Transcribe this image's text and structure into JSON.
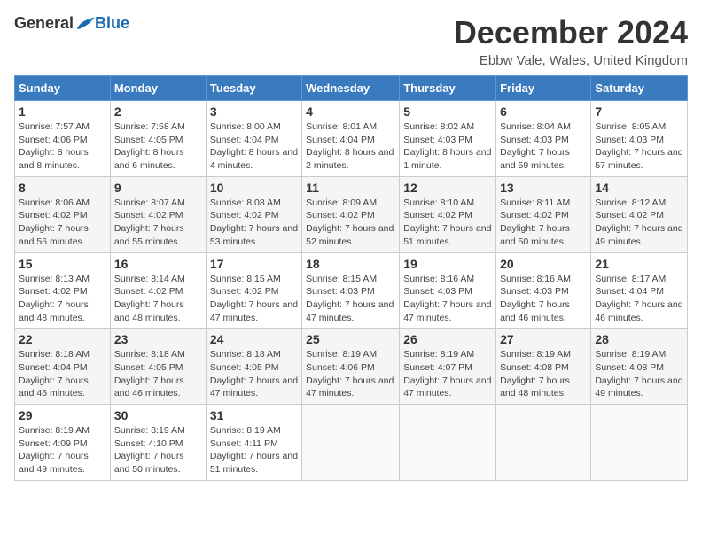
{
  "header": {
    "logo_general": "General",
    "logo_blue": "Blue",
    "month_title": "December 2024",
    "location": "Ebbw Vale, Wales, United Kingdom"
  },
  "days_of_week": [
    "Sunday",
    "Monday",
    "Tuesday",
    "Wednesday",
    "Thursday",
    "Friday",
    "Saturday"
  ],
  "weeks": [
    [
      {
        "day": "1",
        "info": "Sunrise: 7:57 AM\nSunset: 4:06 PM\nDaylight: 8 hours and 8 minutes."
      },
      {
        "day": "2",
        "info": "Sunrise: 7:58 AM\nSunset: 4:05 PM\nDaylight: 8 hours and 6 minutes."
      },
      {
        "day": "3",
        "info": "Sunrise: 8:00 AM\nSunset: 4:04 PM\nDaylight: 8 hours and 4 minutes."
      },
      {
        "day": "4",
        "info": "Sunrise: 8:01 AM\nSunset: 4:04 PM\nDaylight: 8 hours and 2 minutes."
      },
      {
        "day": "5",
        "info": "Sunrise: 8:02 AM\nSunset: 4:03 PM\nDaylight: 8 hours and 1 minute."
      },
      {
        "day": "6",
        "info": "Sunrise: 8:04 AM\nSunset: 4:03 PM\nDaylight: 7 hours and 59 minutes."
      },
      {
        "day": "7",
        "info": "Sunrise: 8:05 AM\nSunset: 4:03 PM\nDaylight: 7 hours and 57 minutes."
      }
    ],
    [
      {
        "day": "8",
        "info": "Sunrise: 8:06 AM\nSunset: 4:02 PM\nDaylight: 7 hours and 56 minutes."
      },
      {
        "day": "9",
        "info": "Sunrise: 8:07 AM\nSunset: 4:02 PM\nDaylight: 7 hours and 55 minutes."
      },
      {
        "day": "10",
        "info": "Sunrise: 8:08 AM\nSunset: 4:02 PM\nDaylight: 7 hours and 53 minutes."
      },
      {
        "day": "11",
        "info": "Sunrise: 8:09 AM\nSunset: 4:02 PM\nDaylight: 7 hours and 52 minutes."
      },
      {
        "day": "12",
        "info": "Sunrise: 8:10 AM\nSunset: 4:02 PM\nDaylight: 7 hours and 51 minutes."
      },
      {
        "day": "13",
        "info": "Sunrise: 8:11 AM\nSunset: 4:02 PM\nDaylight: 7 hours and 50 minutes."
      },
      {
        "day": "14",
        "info": "Sunrise: 8:12 AM\nSunset: 4:02 PM\nDaylight: 7 hours and 49 minutes."
      }
    ],
    [
      {
        "day": "15",
        "info": "Sunrise: 8:13 AM\nSunset: 4:02 PM\nDaylight: 7 hours and 48 minutes."
      },
      {
        "day": "16",
        "info": "Sunrise: 8:14 AM\nSunset: 4:02 PM\nDaylight: 7 hours and 48 minutes."
      },
      {
        "day": "17",
        "info": "Sunrise: 8:15 AM\nSunset: 4:02 PM\nDaylight: 7 hours and 47 minutes."
      },
      {
        "day": "18",
        "info": "Sunrise: 8:15 AM\nSunset: 4:03 PM\nDaylight: 7 hours and 47 minutes."
      },
      {
        "day": "19",
        "info": "Sunrise: 8:16 AM\nSunset: 4:03 PM\nDaylight: 7 hours and 47 minutes."
      },
      {
        "day": "20",
        "info": "Sunrise: 8:16 AM\nSunset: 4:03 PM\nDaylight: 7 hours and 46 minutes."
      },
      {
        "day": "21",
        "info": "Sunrise: 8:17 AM\nSunset: 4:04 PM\nDaylight: 7 hours and 46 minutes."
      }
    ],
    [
      {
        "day": "22",
        "info": "Sunrise: 8:18 AM\nSunset: 4:04 PM\nDaylight: 7 hours and 46 minutes."
      },
      {
        "day": "23",
        "info": "Sunrise: 8:18 AM\nSunset: 4:05 PM\nDaylight: 7 hours and 46 minutes."
      },
      {
        "day": "24",
        "info": "Sunrise: 8:18 AM\nSunset: 4:05 PM\nDaylight: 7 hours and 47 minutes."
      },
      {
        "day": "25",
        "info": "Sunrise: 8:19 AM\nSunset: 4:06 PM\nDaylight: 7 hours and 47 minutes."
      },
      {
        "day": "26",
        "info": "Sunrise: 8:19 AM\nSunset: 4:07 PM\nDaylight: 7 hours and 47 minutes."
      },
      {
        "day": "27",
        "info": "Sunrise: 8:19 AM\nSunset: 4:08 PM\nDaylight: 7 hours and 48 minutes."
      },
      {
        "day": "28",
        "info": "Sunrise: 8:19 AM\nSunset: 4:08 PM\nDaylight: 7 hours and 49 minutes."
      }
    ],
    [
      {
        "day": "29",
        "info": "Sunrise: 8:19 AM\nSunset: 4:09 PM\nDaylight: 7 hours and 49 minutes."
      },
      {
        "day": "30",
        "info": "Sunrise: 8:19 AM\nSunset: 4:10 PM\nDaylight: 7 hours and 50 minutes."
      },
      {
        "day": "31",
        "info": "Sunrise: 8:19 AM\nSunset: 4:11 PM\nDaylight: 7 hours and 51 minutes."
      },
      {
        "day": "",
        "info": ""
      },
      {
        "day": "",
        "info": ""
      },
      {
        "day": "",
        "info": ""
      },
      {
        "day": "",
        "info": ""
      }
    ]
  ]
}
